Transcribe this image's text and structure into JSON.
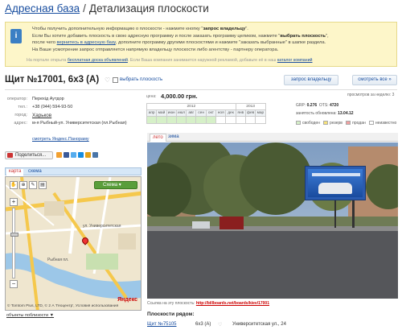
{
  "header": {
    "crumb": "Адресная база",
    "separator": "/",
    "title": "Детализация плоскости"
  },
  "info": {
    "l1_pre": "Чтобы получить дополнительную информацию о плоскости - нажмите кнопку \"",
    "l1_b": "запрос владельцу",
    "l1_post": "\".",
    "l2_pre": "Если Вы хотите добавить плоскость в свою адресную программу и после заказать программу целиком, нажмите \"",
    "l2_b": "выбрать плоскость",
    "l2_post": "\",",
    "l3_pre": "после чего ",
    "l3_link": "вернитесь в адресную базу",
    "l3_post": ", дополните программу другими плоскостями и нажмите \"заказать выбранные\" в шапке раздела.",
    "l4": "На Ваше усмотрение запрос отправляется напрямую владельцу плоскости либо агентству - партнеру оператора.",
    "foot_pre": "На портале открыта ",
    "foot_link1": "бесплатная доска объявлений",
    "foot_mid": ". Если Ваша компания занимается наружной рекламой, добавьте её в наш ",
    "foot_link2": "каталог компаний"
  },
  "surface": {
    "title": "Щит №17001,  6х3 (А)",
    "heart": "♡",
    "select_label": "выбрать плоскость",
    "btn_request": "запрос владельцу",
    "btn_more": "смотреть все »"
  },
  "contacts": [
    {
      "label": "оператор:",
      "value": "Перехід Аутдор"
    },
    {
      "label": "тел.:",
      "value": "+38 (044) 594-93-50"
    },
    {
      "label": "город:",
      "value": "Харьков"
    },
    {
      "label": "адрес:",
      "value": "м-я Рыбный-уп. Университетская (пл.Рыбная)"
    }
  ],
  "pano_link": "смотреть Яндекс.Панораму",
  "share_label": "Поделиться...",
  "map": {
    "tab_map": "карта",
    "tab_sat": "схема",
    "type_label": "Схема",
    "copyright": "© Tomtom Plus, LTD, © 2 А 'Геоцентр', Условия использования",
    "logo": "Яндекс",
    "streets": [
      "Рыбная пл.",
      "ул. Университетская"
    ]
  },
  "map_footer": "объекты поблизости ▼",
  "price": {
    "label": "цена:",
    "value": "4,000.00 грн."
  },
  "views": "просмотров за неделю: 3",
  "occupancy": {
    "years": [
      "2012",
      "2013"
    ],
    "months": [
      "апр",
      "май",
      "июн",
      "июл",
      "авг",
      "сен",
      "окт",
      "ноя",
      "дек",
      "янв",
      "фев",
      "мар"
    ],
    "free": [
      true,
      true,
      true,
      true,
      true,
      true,
      true,
      false,
      false,
      false,
      false,
      false
    ]
  },
  "tech": {
    "grp_label": "GRP:",
    "grp": "0.276",
    "ots_label": "OTS:",
    "ots": "4720",
    "updated_label": "занятость обновлена:",
    "updated": "13.04.12"
  },
  "legend": [
    "свободен",
    "резерв",
    "продан",
    "неизвестно"
  ],
  "photo_tabs": [
    "лето",
    "зима"
  ],
  "photo_link_pre": "Ссылка на эту плоскость: ",
  "photo_link_url": "http://billboards.net/boards/kiev/17001",
  "nearby": {
    "title": "Плоскости рядом:",
    "rows": [
      {
        "id": "Щит №75105",
        "size": "6х3 (А)",
        "heart": "♡",
        "addr": "Университетская ул., 24"
      }
    ]
  },
  "colors": {
    "link": "#1a4fa0",
    "accent_red": "#cc3333",
    "info_bg": "#fdf6c9",
    "free": "#d6f0c8"
  }
}
